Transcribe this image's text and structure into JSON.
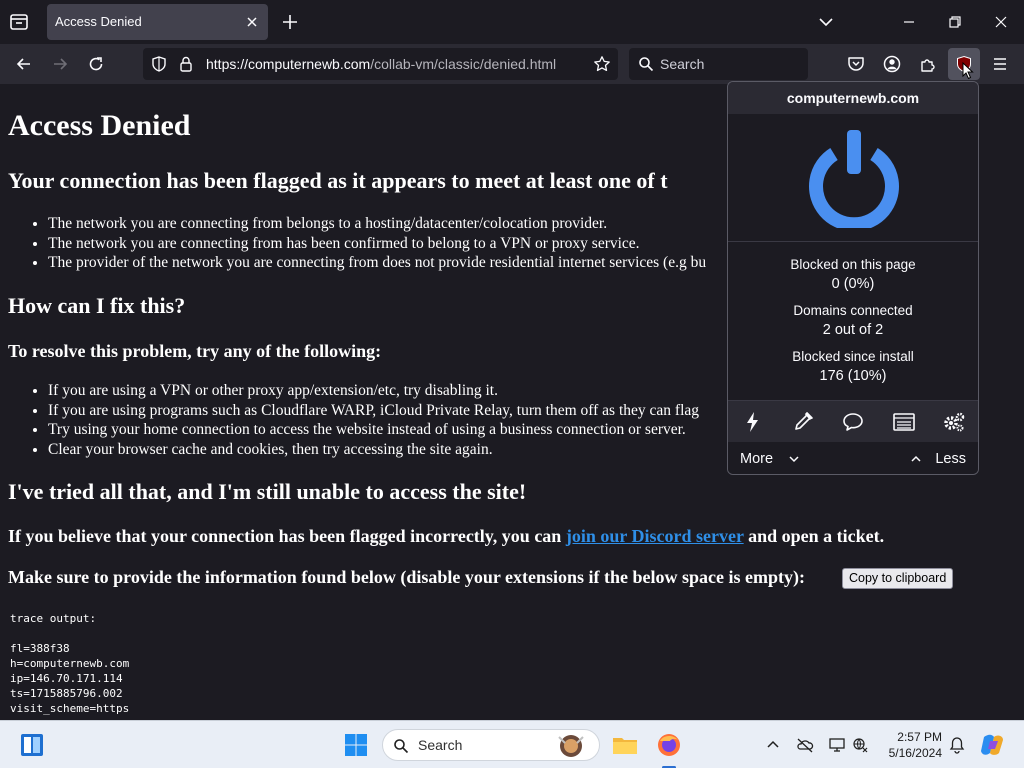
{
  "browser": {
    "tab_title": "Access Denied",
    "url_domain": "https://computernewb.com",
    "url_path": "/collab-vm/classic/denied.html",
    "search_placeholder": "Search"
  },
  "page": {
    "title": "Access Denied",
    "flag_heading": "Your connection has been flagged as it appears to meet at least one of t",
    "reasons": [
      "The network you are connecting from belongs to a hosting/datacenter/colocation provider.",
      "The network you are connecting from has been confirmed to belong to a VPN or proxy service.",
      "The provider of the network you are connecting from does not provide residential internet services (e.g bu"
    ],
    "fix_heading": "How can I fix this?",
    "resolve_heading": "To resolve this problem, try any of the following:",
    "fixes": [
      "If you are using a VPN or other proxy app/extension/etc, try disabling it.",
      "If you are using programs such as Cloudflare WARP, iCloud Private Relay, turn them off as they can flag",
      "Try using your home connection to access the website instead of using a business connection or server.",
      "Clear your browser cache and cookies, then try accessing the site again."
    ],
    "tried_heading": "I've tried all that, and I'm still unable to access the site!",
    "incorrect_prefix": "If you believe that your connection has been flagged incorrectly, you can ",
    "discord_link": "join our Discord server",
    "incorrect_suffix": " and open a ticket.",
    "provide_info": "Make sure to provide the information found below (disable your extensions if the below space is empty):",
    "copy_button": "Copy to clipboard",
    "trace_label": "trace output:",
    "trace_lines": [
      "fl=388f38",
      "h=computernewb.com",
      "ip=146.70.171.114",
      "ts=1715885796.002",
      "visit_scheme=https"
    ]
  },
  "popup": {
    "domain": "computernewb.com",
    "blocked_page_label": "Blocked on this page",
    "blocked_page_value": "0 (0%)",
    "domains_label": "Domains connected",
    "domains_value": "2 out of 2",
    "blocked_install_label": "Blocked since install",
    "blocked_install_value": "176 (10%)",
    "more_label": "More",
    "less_label": "Less",
    "power_color": "#4a8ff0"
  },
  "taskbar": {
    "search_placeholder": "Search",
    "time": "2:57 PM",
    "date": "5/16/2024"
  }
}
